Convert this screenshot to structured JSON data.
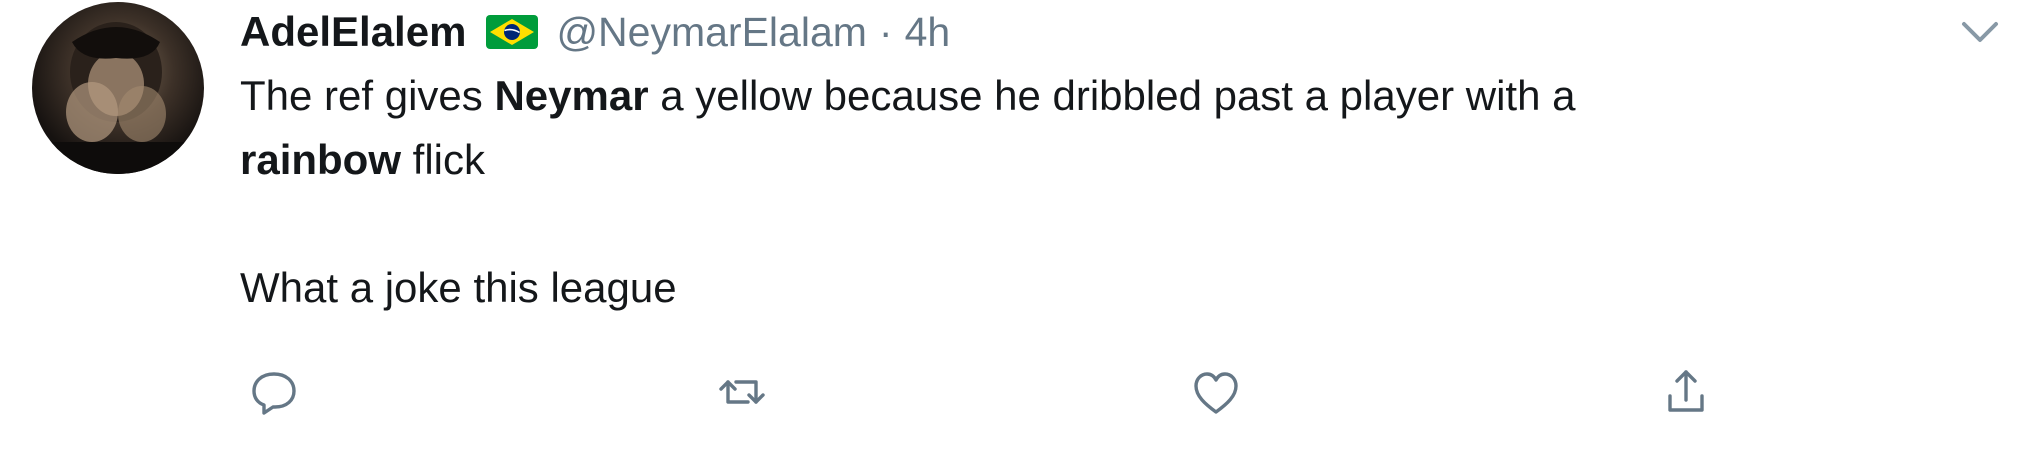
{
  "tweet": {
    "author": {
      "display_name": "AdelElalem",
      "handle": "@NeymarElalam",
      "flag_icon": "brazil-flag-icon"
    },
    "separator": "·",
    "time": "4h",
    "body": {
      "line1_a": "The ref gives ",
      "line1_bold": "Neymar",
      "line1_b": " a yellow because he dribbled past a player with a",
      "line2_bold": "rainbow",
      "line2_b": " flick",
      "line3": "What a joke this league"
    },
    "actions": [
      "reply-icon",
      "retweet-icon",
      "like-icon",
      "share-icon"
    ],
    "menu_icon": "chevron-down-icon",
    "colors": {
      "text": "#14171a",
      "secondary": "#657786",
      "flag_green": "#009c3b",
      "flag_yellow": "#ffdf00",
      "flag_blue": "#002776"
    }
  }
}
